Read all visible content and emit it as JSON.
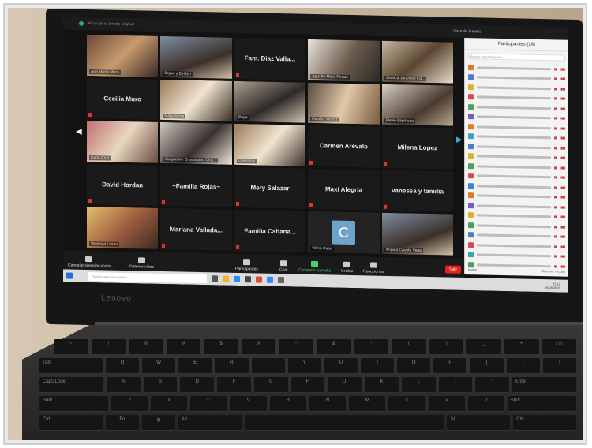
{
  "topbar": {
    "title": "Alcanzar el ámbito original",
    "view": "Vista de Galería"
  },
  "tiles": [
    {
      "name": "Ana Maria Muro",
      "kind": "video",
      "v": "v1"
    },
    {
      "name": "Bryan y Evelyn",
      "kind": "video",
      "v": "v2"
    },
    {
      "name": "Fam. Diaz Valla...",
      "kind": "name"
    },
    {
      "name": "Agustín Muro Roque",
      "kind": "video",
      "v": "v3"
    },
    {
      "name": "Jessica Jaramillo Fa...",
      "kind": "video",
      "v": "v4"
    },
    {
      "name": "Cecilia Muro",
      "kind": "name"
    },
    {
      "name": "Magdalena",
      "kind": "video",
      "v": "v5"
    },
    {
      "name": "Pepe",
      "kind": "video",
      "v": "v6"
    },
    {
      "name": "Familia Muñoz",
      "kind": "video",
      "v": "v7"
    },
    {
      "name": "Flavio Espinoza",
      "kind": "video",
      "v": "v8"
    },
    {
      "name": "Karla Cruz",
      "kind": "video",
      "v": "v9"
    },
    {
      "name": "Jacqueline Crisostomo Chá...",
      "kind": "video",
      "v": "v11"
    },
    {
      "name": "Celestina",
      "kind": "video",
      "v": "v5"
    },
    {
      "name": "Carmen Arévalo",
      "kind": "name"
    },
    {
      "name": "Milena Lopez",
      "kind": "name"
    },
    {
      "name": "David Hordan",
      "kind": "name"
    },
    {
      "name": "~Familia Rojas~",
      "kind": "name"
    },
    {
      "name": "Mery Salazar",
      "kind": "name"
    },
    {
      "name": "Maxi Alegría",
      "kind": "name"
    },
    {
      "name": "Vanessa y familia",
      "kind": "name"
    },
    {
      "name": "Vanessa Lasso",
      "kind": "video",
      "v": "v10"
    },
    {
      "name": "Mariana Vallada...",
      "kind": "name"
    },
    {
      "name": "Familia Cabana...",
      "kind": "name"
    },
    {
      "name": "Vilma Cuba",
      "kind": "avatar",
      "letter": "C"
    },
    {
      "name": "Angela Cayelo Vega",
      "kind": "video",
      "v": "v2"
    }
  ],
  "panel": {
    "title": "Participantes (26)",
    "search": "Buscar un participante",
    "footer_left": "Invitar",
    "footer_right": "Silenciar a todos",
    "avatar_colors": [
      "#e07a2f",
      "#4d7fc1",
      "#e0b12f",
      "#d94b4b",
      "#4aa061",
      "#7a5bc1",
      "#e07a2f",
      "#3aa7b5",
      "#4d7fc1",
      "#e0b12f",
      "#4aa061",
      "#d94b4b",
      "#3a86d4",
      "#e07a2f",
      "#7a5bc1",
      "#e0b12f",
      "#4aa061",
      "#4d7fc1",
      "#d94b4b",
      "#3aa7b5",
      "#4aa061"
    ]
  },
  "controls": {
    "mute": "Cancelar silenciar ahora",
    "video": "Detener video",
    "participants": "Participantes",
    "participants_count": "26",
    "chat": "Chat",
    "share": "Compartir pantalla",
    "record": "Grabar",
    "reactions": "Reacciones",
    "end": "Salir"
  },
  "taskbar": {
    "search": "Escribe aquí para buscar",
    "time": "23:12",
    "date": "15/06/2020"
  },
  "brand": "Lenovo",
  "keyboard": {
    "row1": [
      "~",
      "!",
      "@",
      "#",
      "$",
      "%",
      "^",
      "&",
      "*",
      "(",
      ")",
      "_",
      "+",
      "⌫"
    ],
    "row2": [
      "Tab",
      "Q",
      "W",
      "E",
      "R",
      "T",
      "Y",
      "U",
      "I",
      "O",
      "P",
      "{",
      "}",
      "|"
    ],
    "row3": [
      "Caps Lock",
      "A",
      "S",
      "D",
      "F",
      "G",
      "H",
      "J",
      "K",
      "L",
      ":",
      "\"",
      "Enter"
    ],
    "row4": [
      "Shift",
      "Z",
      "X",
      "C",
      "V",
      "B",
      "N",
      "M",
      "<",
      ">",
      "?",
      "Shift"
    ],
    "row5": [
      "Ctrl",
      "Fn",
      "⊞",
      "Alt",
      "",
      "Alt",
      "Ctrl"
    ]
  }
}
